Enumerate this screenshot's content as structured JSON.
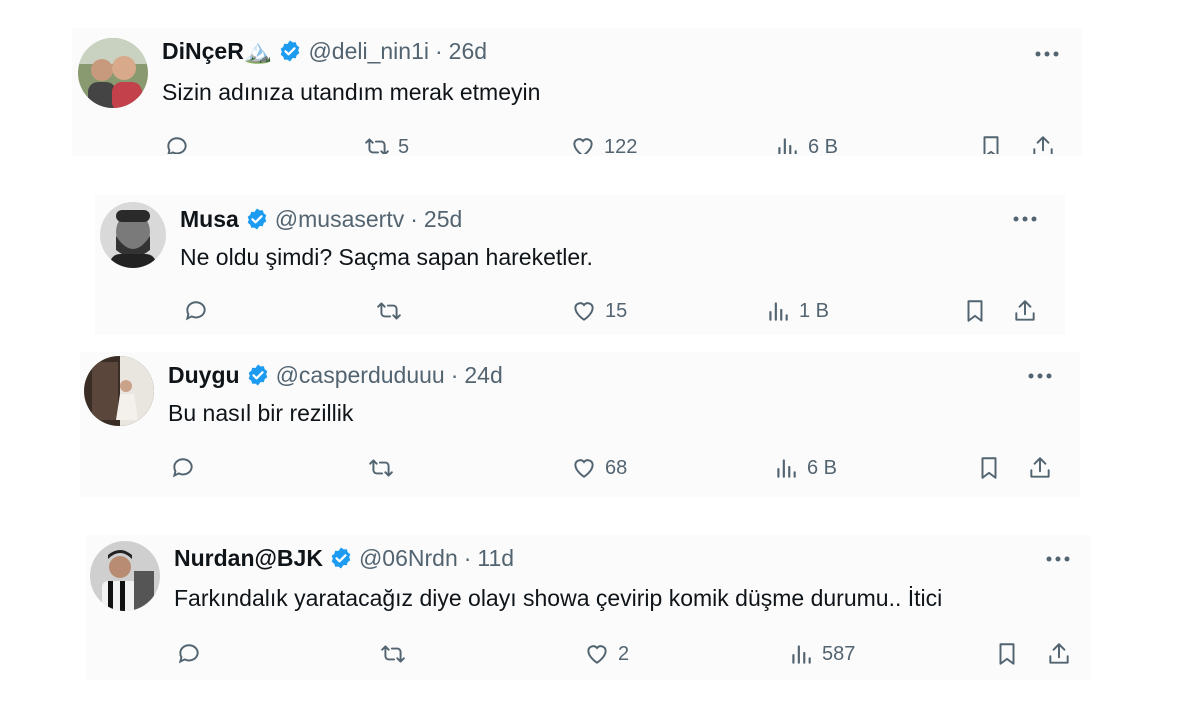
{
  "colors": {
    "accent": "#1d9bf0",
    "muted": "#536471",
    "text": "#0f1419"
  },
  "tweets": [
    {
      "name": "DiNçeR🏔️",
      "handle": "@deli_nin1i",
      "sep": "·",
      "time": "26d",
      "text": "Sizin adınıza utandım merak etmeyin",
      "retweets": "5",
      "likes": "122",
      "views": "6 B",
      "avatar_icon": "person-photo"
    },
    {
      "name": "Musa",
      "handle": "@musasertv",
      "sep": "·",
      "time": "25d",
      "text": "Ne oldu şimdi? Saçma sapan hareketler.",
      "retweets": "",
      "likes": "15",
      "views": "1 B",
      "avatar_icon": "person-photo"
    },
    {
      "name": "Duygu",
      "handle": "@casperduduuu",
      "sep": "·",
      "time": "24d",
      "text": "Bu nasıl bir rezillik",
      "retweets": "",
      "likes": "68",
      "views": "6 B",
      "avatar_icon": "person-photo"
    },
    {
      "name": "Nurdan@BJK",
      "handle": "@06Nrdn",
      "sep": "·",
      "time": "11d",
      "text": "Farkındalık yaratacağız diye olayı showa çevirip komik düşme durumu.. İtici",
      "retweets": "",
      "likes": "2",
      "views": "587",
      "avatar_icon": "person-photo"
    }
  ]
}
